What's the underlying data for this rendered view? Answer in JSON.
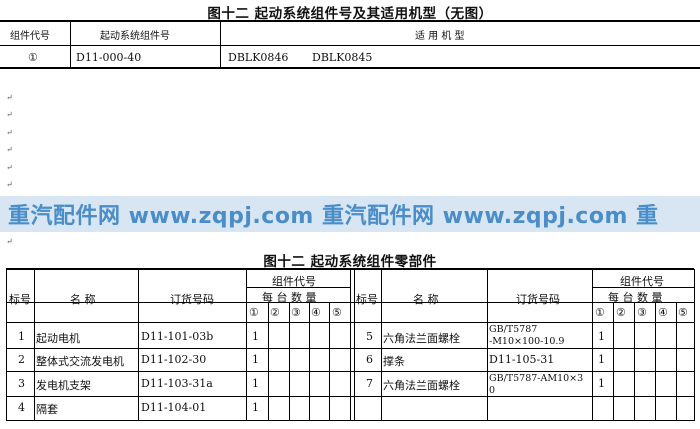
{
  "table1": {
    "title": "图十二    起动系统组件号及其适用机型（无图）",
    "headers": [
      "组件代号",
      "起动系统组件号",
      "适   用   机   型"
    ],
    "row": {
      "code": "①",
      "assembly": "D11-000-40",
      "model_a": "DBLK0846",
      "model_b": "DBLK0845"
    }
  },
  "watermark": "重汽配件网  www.zqpj.com  重汽配件网  www.zqpj.com  重",
  "table2": {
    "title": "图十二    起动系统组件零部件",
    "headers": {
      "no": "标号",
      "name": "名    称",
      "order": "订货号码",
      "group_top": "组件代号",
      "group_sub": "每 台 数 量",
      "circles": [
        "①",
        "②",
        "③",
        "④",
        "⑤"
      ]
    },
    "rows_left": [
      {
        "no": "1",
        "name": "起动电机",
        "order": "D11-101-03b",
        "q": "1"
      },
      {
        "no": "2",
        "name": "整体式交流发电机",
        "order": "D11-102-30",
        "q": "1"
      },
      {
        "no": "3",
        "name": "发电机支架",
        "order": "D11-103-31a",
        "q": "1"
      },
      {
        "no": "4",
        "name": "隔套",
        "order": "D11-104-01",
        "q": "1"
      }
    ],
    "rows_right": [
      {
        "no": "5",
        "name": "六角法兰面螺栓",
        "order_line1": "GB/T5787",
        "order_line2": "-M10×100-10.9",
        "q": "1"
      },
      {
        "no": "6",
        "name": "撑条",
        "order_line1": "D11-105-31",
        "order_line2": "",
        "q": "1"
      },
      {
        "no": "7",
        "name": "六角法兰面螺栓",
        "order_line1": "GB/T5787-AM10×3",
        "order_line2": "0",
        "q": "1"
      },
      {
        "no": "",
        "name": "",
        "order_line1": "",
        "order_line2": "",
        "q": ""
      }
    ]
  }
}
